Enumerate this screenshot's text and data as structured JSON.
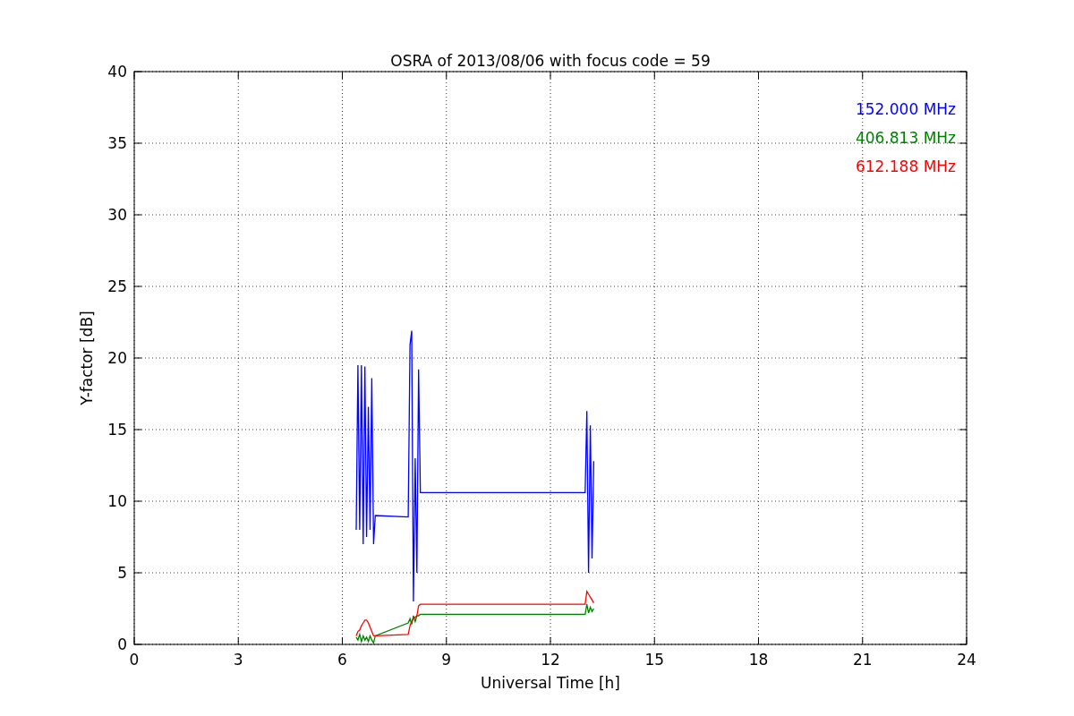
{
  "chart_data": {
    "type": "line",
    "title": "OSRA of 2013/08/06 with focus code = 59",
    "xlabel": "Universal Time [h]",
    "ylabel": "Y-factor [dB]",
    "x": [
      6.4,
      6.45,
      6.5,
      6.55,
      6.6,
      6.65,
      6.7,
      6.75,
      6.8,
      6.85,
      6.9,
      6.95,
      7.9,
      7.95,
      8.0,
      8.05,
      8.1,
      8.15,
      8.2,
      8.25,
      13.0,
      13.05,
      13.1,
      13.15,
      13.2,
      13.25
    ],
    "series": [
      {
        "name": "152.000 MHz",
        "color": "#0000ff",
        "values": [
          8,
          19.5,
          8,
          19.5,
          7,
          19.4,
          7.5,
          16.6,
          8,
          18.6,
          7,
          9,
          8.9,
          20.9,
          21.9,
          3,
          13,
          5,
          19.2,
          10.6,
          10.6,
          16.3,
          5,
          15.3,
          6,
          12.8
        ]
      },
      {
        "name": "406.813 MHz",
        "color": "#008000",
        "values": [
          0.5,
          0.3,
          0.7,
          0.2,
          0.6,
          0.3,
          0.5,
          0.2,
          0.6,
          0.3,
          0.1,
          0.6,
          1.5,
          1.8,
          1.4,
          2.0,
          1.6,
          2.0,
          2.0,
          2.1,
          2.1,
          2.8,
          2.2,
          2.6,
          2.3,
          2.5
        ]
      },
      {
        "name": "612.188 MHz",
        "color": "#ff0000",
        "values": [
          0.6,
          0.9,
          1.0,
          1.3,
          1.5,
          1.7,
          1.7,
          1.5,
          1.2,
          0.9,
          0.6,
          0.6,
          0.7,
          1.3,
          1.6,
          1.8,
          1.9,
          2.0,
          2.7,
          2.8,
          2.8,
          3.7,
          3.5,
          3.3,
          3.1,
          2.9
        ]
      }
    ],
    "xlim": [
      0,
      24
    ],
    "ylim": [
      0,
      40
    ],
    "xticks": [
      0,
      3,
      6,
      9,
      12,
      15,
      18,
      21,
      24
    ],
    "yticks": [
      0,
      5,
      10,
      15,
      20,
      25,
      30,
      35,
      40
    ],
    "grid": true
  }
}
